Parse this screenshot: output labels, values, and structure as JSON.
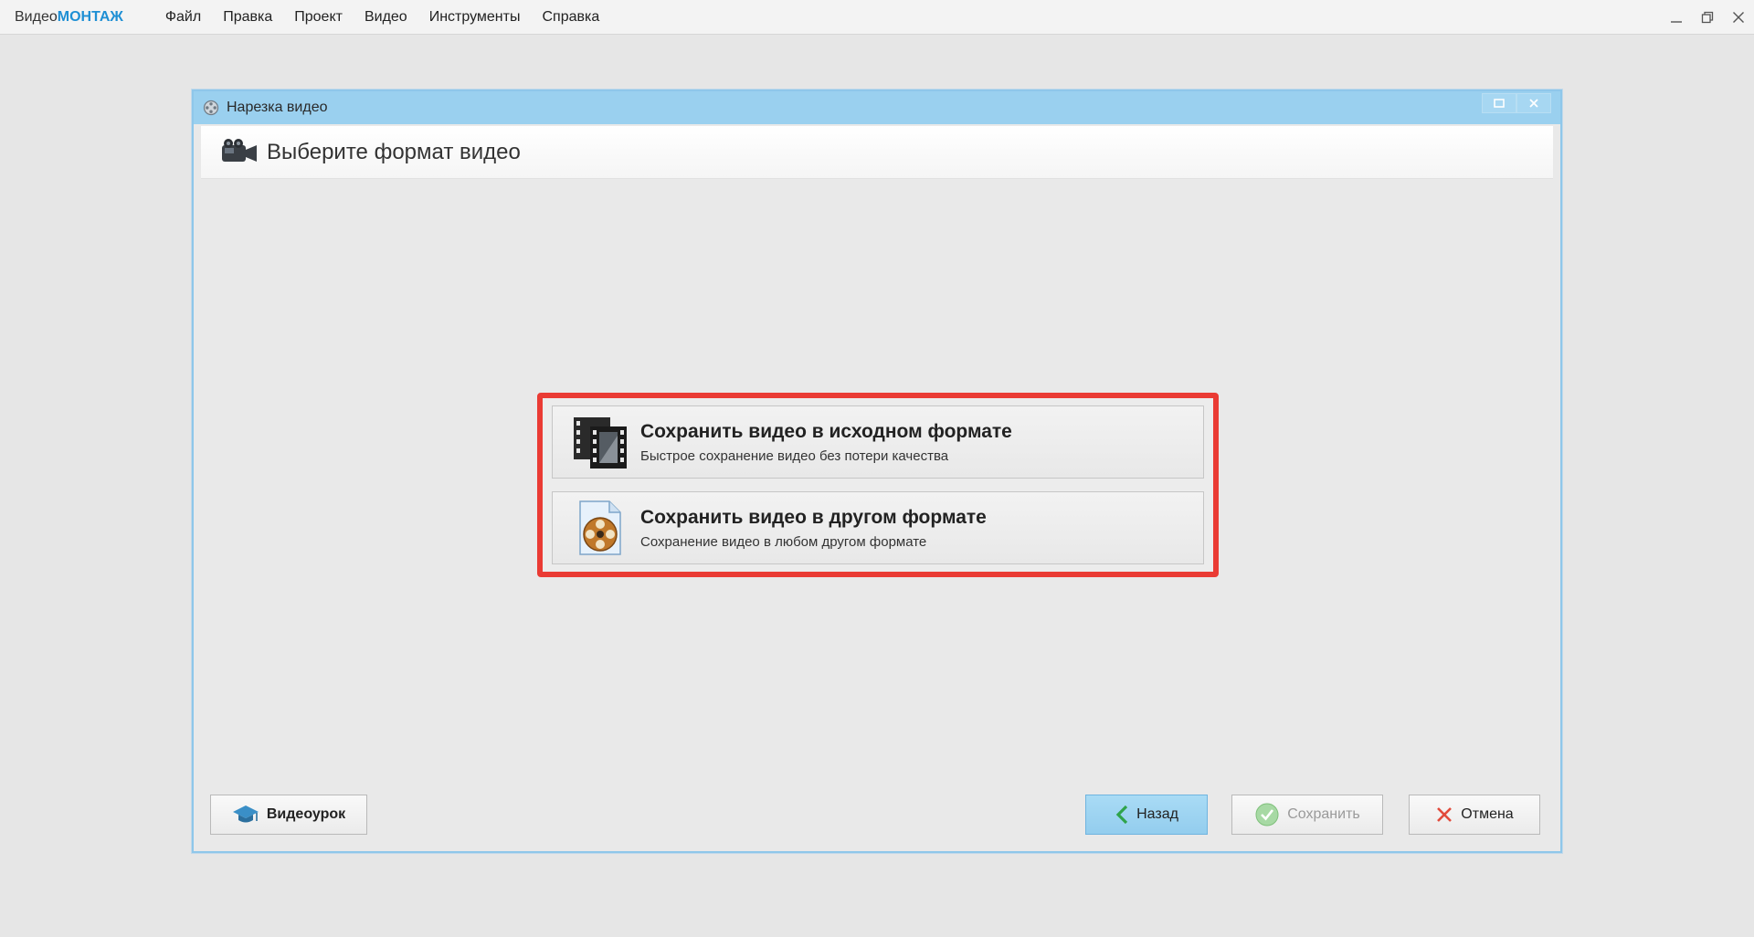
{
  "app": {
    "logo_part1": "Видео",
    "logo_part2": "МОНТАЖ",
    "menu": [
      "Файл",
      "Правка",
      "Проект",
      "Видео",
      "Инструменты",
      "Справка"
    ]
  },
  "dialog": {
    "title": "Нарезка видео",
    "header": "Выберите формат видео"
  },
  "options": [
    {
      "title": "Сохранить видео в исходном формате",
      "description": "Быстрое сохранение видео без потери качества",
      "icon": "film-frames-icon"
    },
    {
      "title": "Сохранить видео в другом формате",
      "description": "Сохранение видео в любом другом формате",
      "icon": "film-reel-icon"
    }
  ],
  "buttons": {
    "tutorial": "Видеоурок",
    "back": "Назад",
    "save": "Сохранить",
    "cancel": "Отмена"
  },
  "colors": {
    "accent": "#1e8fd4",
    "dialog_titlebar": "#9ad0ef",
    "highlight": "#ea3b34"
  }
}
